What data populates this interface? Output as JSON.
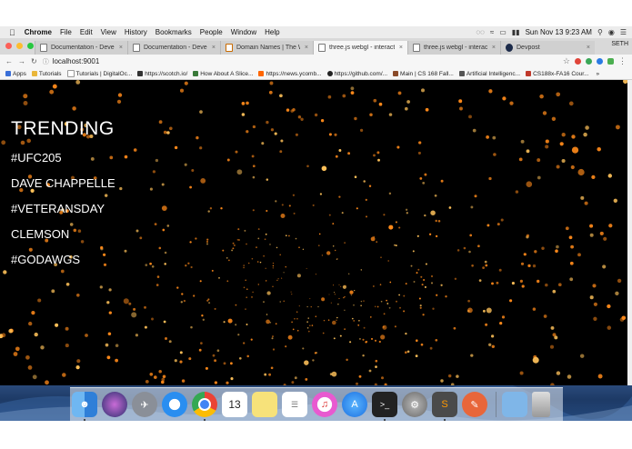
{
  "menubar": {
    "app": "Chrome",
    "items": [
      "File",
      "Edit",
      "View",
      "History",
      "Bookmarks",
      "People",
      "Window",
      "Help"
    ],
    "clock": "Sun Nov 13  9:23 AM"
  },
  "tabs": [
    {
      "label": "Documentation - Develope"
    },
    {
      "label": "Documentation - Develope"
    },
    {
      "label": "Domain Names | The Worl"
    },
    {
      "label": "three.js webgl - interactive"
    },
    {
      "label": "three.js webgl - interactive"
    },
    {
      "label": "Devpost"
    }
  ],
  "profile_name": "SETH",
  "address": {
    "url": "localhost:9001"
  },
  "bookmarks": [
    {
      "label": "Apps"
    },
    {
      "label": "Tutorials"
    },
    {
      "label": "Tutorials | DigitalOc..."
    },
    {
      "label": "https://scotch.io/"
    },
    {
      "label": "How About A Slice..."
    },
    {
      "label": "https://news.ycomb..."
    },
    {
      "label": "https://github.com/..."
    },
    {
      "label": "Main | CS 168 Fall..."
    },
    {
      "label": "Artificial Intelligenc..."
    },
    {
      "label": "CS188x-FA16 Cour..."
    }
  ],
  "trending": {
    "title": "TRENDING",
    "items": [
      "#UFC205",
      "DAVE CHAPPELLE",
      "#VETERANSDAY",
      "CLEMSON",
      "#GODAWGS"
    ]
  },
  "dock": {
    "calendar_day": "13",
    "apps": [
      "finder",
      "siri",
      "launchpad",
      "safari",
      "chrome",
      "calendar",
      "notes",
      "reminders",
      "itunes",
      "app-store",
      "terminal",
      "system-preferences",
      "sublime-text",
      "kite"
    ],
    "tray": [
      "downloads-folder",
      "trash"
    ]
  },
  "colors": {
    "particle": "#ff8a1a",
    "particle_bright": "#ffc25a",
    "stage_bg": "#000000"
  }
}
